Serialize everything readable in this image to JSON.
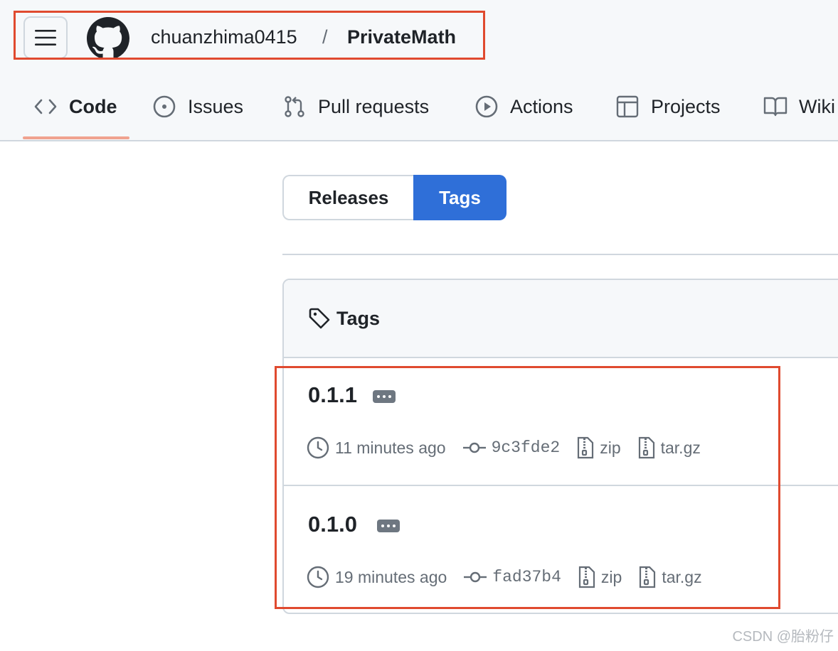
{
  "header": {
    "owner": "chuanzhima0415",
    "separator": "/",
    "repo": "PrivateMath"
  },
  "nav": {
    "tabs": [
      {
        "label": "Code",
        "icon": "code-icon",
        "active": true
      },
      {
        "label": "Issues",
        "icon": "issue-opened-icon"
      },
      {
        "label": "Pull requests",
        "icon": "git-pull-request-icon"
      },
      {
        "label": "Actions",
        "icon": "play-icon"
      },
      {
        "label": "Projects",
        "icon": "table-icon"
      },
      {
        "label": "Wiki",
        "icon": "book-icon"
      }
    ]
  },
  "toggle": {
    "releases_label": "Releases",
    "tags_label": "Tags",
    "selected": "Tags"
  },
  "tags_box": {
    "title": "Tags",
    "items": [
      {
        "name": "0.1.1",
        "time": "11 minutes ago",
        "sha": "9c3fde2",
        "zip": "zip",
        "targz": "tar.gz"
      },
      {
        "name": "0.1.0",
        "time": "19 minutes ago",
        "sha": "fad37b4",
        "zip": "zip",
        "targz": "tar.gz"
      }
    ]
  },
  "watermark": "CSDN @胎粉仔",
  "colors": {
    "accent": "#2f6fd8",
    "highlight_box": "#e04a2f",
    "tab_underline": "#f0a28f"
  }
}
